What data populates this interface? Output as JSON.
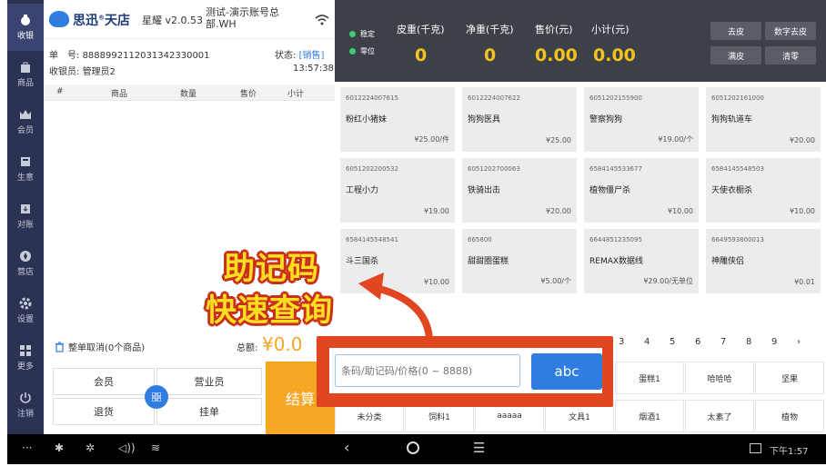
{
  "sidebar": {
    "items": [
      {
        "label": "收银",
        "icon": "money-bag-icon"
      },
      {
        "label": "商品",
        "icon": "bag-icon"
      },
      {
        "label": "会员",
        "icon": "crown-icon"
      },
      {
        "label": "生意",
        "icon": "register-icon"
      },
      {
        "label": "对账",
        "icon": "download-icon"
      },
      {
        "label": "营店",
        "icon": "compass-icon"
      },
      {
        "label": "设置",
        "icon": "gear-icon"
      },
      {
        "label": "更多",
        "icon": "grid-icon"
      },
      {
        "label": "注销",
        "icon": "power-icon"
      }
    ]
  },
  "header": {
    "brand": "思迅",
    "brand2": "天店",
    "product": "星耀",
    "version": "v2.0.53",
    "store_line1": "测试-演示账号总",
    "store_line2": "部.WH"
  },
  "order": {
    "no_label": "单　号:",
    "no_value": "8888992112031342330001",
    "status_label": "状态:",
    "status_value": "[销售]",
    "cashier_label": "收银员:",
    "cashier_value": "管理员2",
    "time": "13:57:38"
  },
  "cart": {
    "columns": [
      "#",
      "商品",
      "数量",
      "售价",
      "小计"
    ],
    "clear_label": "整单取消(0个商品)",
    "total_label": "总额:",
    "total_value": "¥0.0"
  },
  "actions": {
    "member": "会员",
    "sales": "营业员",
    "refund": "退货",
    "hang": "挂单",
    "checkout": "结算"
  },
  "scale": {
    "stable": "稳定",
    "zero": "零位",
    "tare_label": "皮重(千克)",
    "tare_value": "0",
    "net_label": "净重(千克)",
    "net_value": "0",
    "price_label": "售价(元)",
    "price_value": "0.00",
    "subtotal_label": "小计(元)",
    "subtotal_value": "0.00",
    "btn_tare": "去皮",
    "btn_digital_tare": "数字去皮",
    "btn_full_tare": "满皮",
    "btn_zero": "清零"
  },
  "products": [
    {
      "code": "6012224007615",
      "name": "粉红小猪妹",
      "price": "¥25.00/件"
    },
    {
      "code": "6012224007622",
      "name": "狗狗医具",
      "price": "¥25.00"
    },
    {
      "code": "6051202155900",
      "name": "警察狗狗",
      "price": "¥19.00/个"
    },
    {
      "code": "6051202161000",
      "name": "狗狗轨道车",
      "price": "¥20.00"
    },
    {
      "code": "6051202200532",
      "name": "工程小力",
      "price": "¥19.00"
    },
    {
      "code": "6051202700063",
      "name": "铁骑出击",
      "price": "¥20.00"
    },
    {
      "code": "6584145533677",
      "name": "植物僵尸杀",
      "price": "¥10.00"
    },
    {
      "code": "6584145548503",
      "name": "天使衣橱杀",
      "price": "¥10.00"
    },
    {
      "code": "6584145548541",
      "name": "斗三国杀",
      "price": "¥10.00"
    },
    {
      "code": "665800",
      "name": "甜甜圈蛋糕",
      "price": "¥5.00/个"
    },
    {
      "code": "6644851235095",
      "name": "REMAX数据线",
      "price": "¥29.00/无单位"
    },
    {
      "code": "6649593800013",
      "name": "神雕侠侣",
      "price": "¥0.01"
    }
  ],
  "pagination": [
    "3",
    "4",
    "5",
    "6",
    "7",
    "8",
    "9",
    "›"
  ],
  "categories_row1": [
    "蛋糕1",
    "哈哈哈",
    "坚果"
  ],
  "categories_row2": [
    "未分类",
    "饲料1",
    "aaaaa",
    "文具1",
    "烟酒1",
    "太素了",
    "植物"
  ],
  "search": {
    "placeholder": "条码/助记码/价格(0 ~ 8888)",
    "abc_label": "abc"
  },
  "overlay": {
    "line1": "助记码",
    "line2": "快速查询"
  },
  "statusbar": {
    "time": "下午1:57"
  },
  "colors": {
    "sidebar": "#2c3254",
    "accent": "#2f7de1",
    "checkout": "#f5a623",
    "overlay": "#e0461f"
  }
}
